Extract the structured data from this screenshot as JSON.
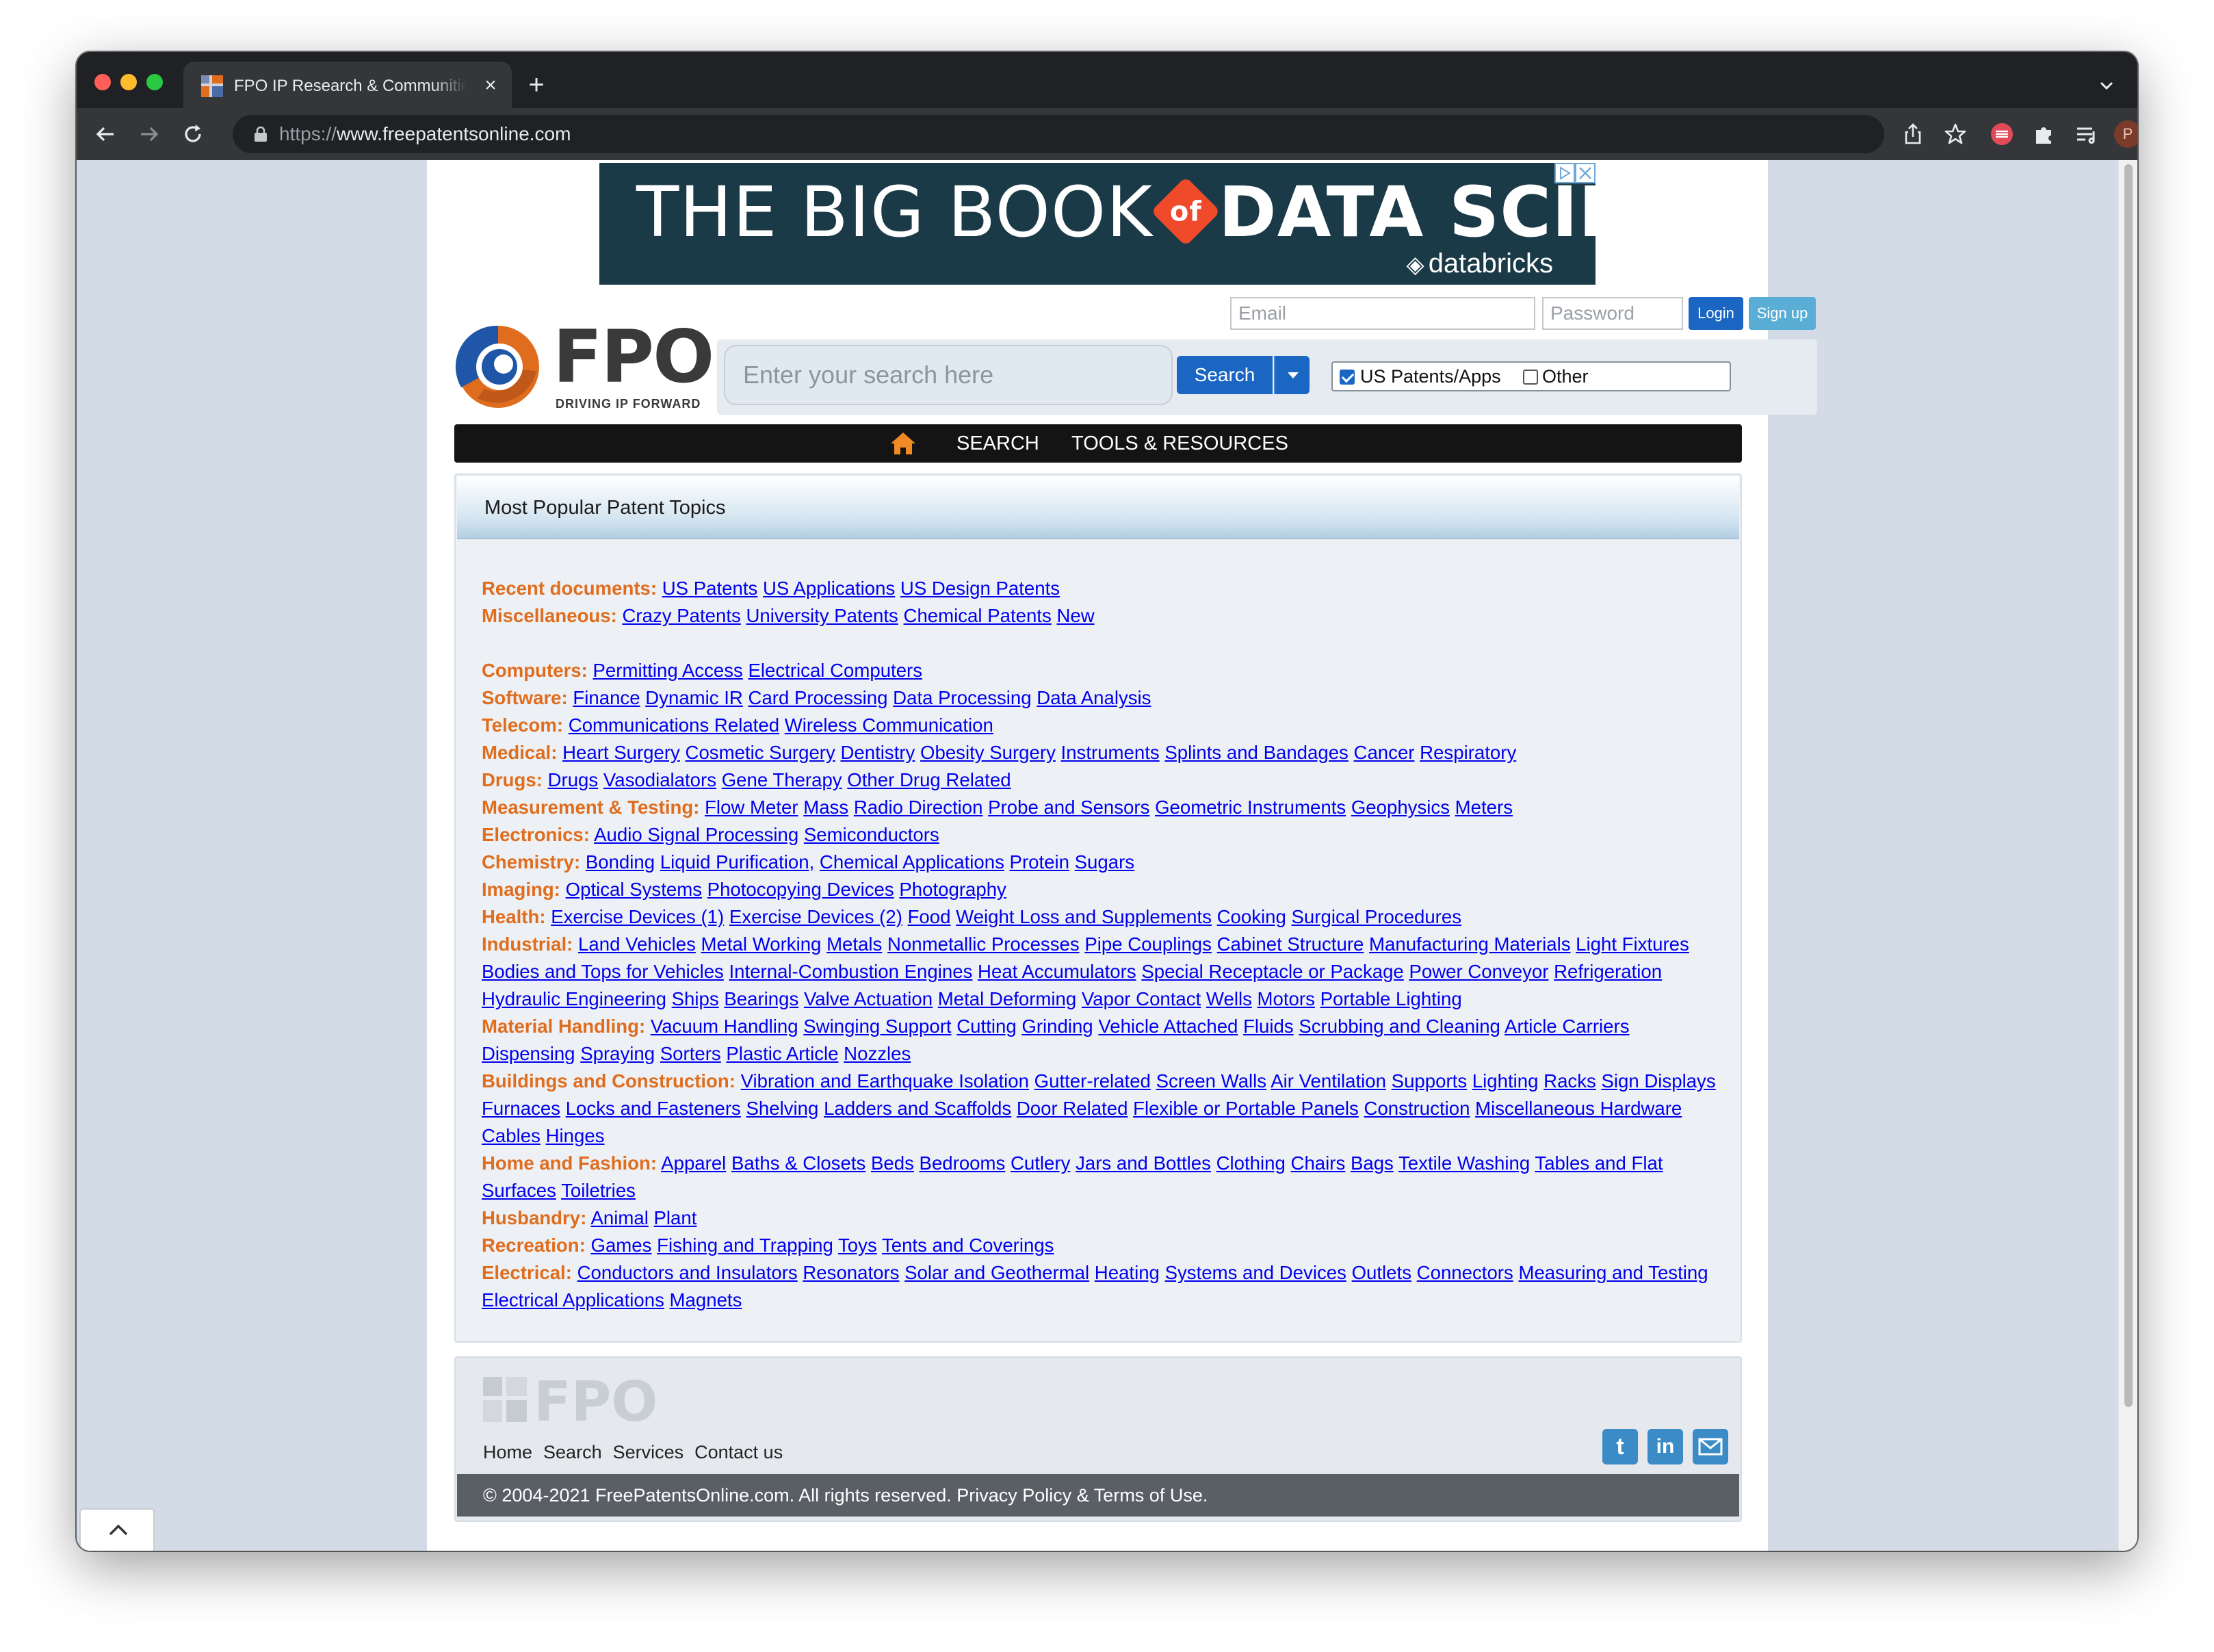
{
  "browser": {
    "tab_title": "FPO IP Research & Communities",
    "tab_close": "×",
    "new_tab": "+",
    "url_scheme": "https://",
    "url_host": "www.freepatentsonline.com",
    "profile_initial": "P"
  },
  "ad": {
    "headline_left": "THE BIG BOOK",
    "headline_of": "of",
    "headline_right": "DATA SCIENCE",
    "brand": "databricks",
    "brand_color": "#ef4b2a"
  },
  "auth": {
    "email_placeholder": "Email",
    "password_placeholder": "Password",
    "login_label": "Login",
    "signup_label": "Sign up"
  },
  "logo": {
    "wordmark": "FPO",
    "tagline": "DRIVING IP FORWARD"
  },
  "search": {
    "placeholder": "Enter your search here",
    "button_label": "Search",
    "scopes": [
      {
        "label": "US Patents/Apps",
        "checked": true
      },
      {
        "label": "Other",
        "checked": false
      }
    ]
  },
  "nav": {
    "home_icon": "home-icon",
    "items": [
      "SEARCH",
      "TOOLS & RESOURCES"
    ]
  },
  "topics_panel": {
    "title": "Most Popular Patent Topics"
  },
  "topic_groups": [
    {
      "category": "Recent documents:",
      "links": [
        "US Patents",
        "US Applications",
        "US Design Patents"
      ]
    },
    {
      "category": "Miscellaneous:",
      "links": [
        "Crazy Patents",
        "University Patents",
        "Chemical Patents",
        "New"
      ]
    },
    {
      "category": "Computers:",
      "links": [
        "Permitting Access",
        "Electrical Computers"
      ]
    },
    {
      "category": "Software:",
      "links": [
        "Finance",
        "Dynamic IR",
        "Card Processing",
        "Data Processing",
        "Data Analysis"
      ]
    },
    {
      "category": "Telecom:",
      "links": [
        "Communications Related",
        "Wireless Communication"
      ]
    },
    {
      "category": "Medical:",
      "links": [
        "Heart Surgery",
        "Cosmetic Surgery",
        "Dentistry",
        "Obesity Surgery",
        "Instruments",
        "Splints and Bandages",
        "Cancer",
        "Respiratory"
      ]
    },
    {
      "category": "Drugs:",
      "links": [
        "Drugs",
        "Vasodialators",
        "Gene Therapy",
        "Other Drug Related"
      ]
    },
    {
      "category": "Measurement & Testing:",
      "links": [
        "Flow Meter",
        "Mass",
        "Radio Direction",
        "Probe and Sensors",
        "Geometric Instruments",
        "Geophysics",
        "Meters"
      ]
    },
    {
      "category": "Electronics:",
      "links": [
        "Audio Signal Processing",
        "Semiconductors"
      ]
    },
    {
      "category": "Chemistry:",
      "links": [
        "Bonding",
        "Liquid Purification,",
        "Chemical Applications",
        "Protein",
        "Sugars"
      ]
    },
    {
      "category": "Imaging:",
      "links": [
        "Optical Systems",
        "Photocopying Devices",
        "Photography"
      ]
    },
    {
      "category": "Health:",
      "links": [
        "Exercise Devices (1)",
        "Exercise Devices (2)",
        "Food",
        "Weight Loss and Supplements",
        "Cooking",
        "Surgical Procedures"
      ]
    },
    {
      "category": "Industrial:",
      "links": [
        "Land Vehicles",
        "Metal Working",
        "Metals",
        "Nonmetallic Processes",
        "Pipe Couplings",
        "Cabinet Structure",
        "Manufacturing Materials",
        "Light Fixtures",
        "Bodies and Tops for Vehicles",
        "Internal-Combustion Engines",
        "Heat Accumulators",
        "Special Receptacle or Package",
        "Power Conveyor",
        "Refrigeration",
        "Hydraulic Engineering",
        "Ships",
        "Bearings",
        "Valve Actuation",
        "Metal Deforming",
        "Vapor Contact",
        "Wells",
        "Motors",
        "Portable Lighting"
      ]
    },
    {
      "category": "Material Handling:",
      "links": [
        "Vacuum Handling",
        "Swinging Support",
        "Cutting",
        "Grinding",
        "Vehicle Attached",
        "Fluids",
        "Scrubbing and Cleaning",
        "Article Carriers",
        "Dispensing",
        "Spraying",
        "Sorters",
        "Plastic Article",
        "Nozzles"
      ]
    },
    {
      "category": "Buildings and Construction:",
      "links": [
        "Vibration and Earthquake Isolation",
        "Gutter-related",
        "Screen Walls",
        "Air Ventilation",
        "Supports",
        "Lighting",
        "Racks",
        "Sign Displays",
        "Furnaces",
        "Locks and Fasteners",
        "Shelving",
        "Ladders and Scaffolds",
        "Door Related",
        "Flexible or Portable Panels",
        "Construction",
        "Miscellaneous Hardware",
        "Cables",
        "Hinges"
      ]
    },
    {
      "category": "Home and Fashion:",
      "links": [
        "Apparel",
        "Baths & Closets",
        "Beds",
        "Bedrooms",
        "Cutlery",
        "Jars and Bottles",
        "Clothing",
        "Chairs",
        "Bags",
        "Textile Washing",
        "Tables and Flat Surfaces",
        "Toiletries"
      ]
    },
    {
      "category": "Husbandry:",
      "links": [
        "Animal",
        "Plant"
      ]
    },
    {
      "category": "Recreation:",
      "links": [
        "Games",
        "Fishing and Trapping",
        "Toys",
        "Tents and Coverings"
      ]
    },
    {
      "category": "Electrical:",
      "links": [
        "Conductors and Insulators",
        "Resonators",
        "Solar and Geothermal",
        "Heating",
        "Systems and Devices",
        "Outlets",
        "Connectors",
        "Measuring and Testing",
        "Electrical Applications",
        "Magnets"
      ]
    }
  ],
  "footer": {
    "logo_text": "FPO",
    "nav": [
      "Home",
      "Search",
      "Services",
      "Contact us"
    ],
    "social": [
      "twitter-icon",
      "linkedin-icon",
      "email-icon"
    ],
    "copyright": "© 2004-2021 FreePatentsOnline.com. All rights reserved. Privacy Policy & Terms of Use."
  },
  "colors": {
    "category": "#e06d1e",
    "link": "#0000ee",
    "accent": "#1a66c2",
    "page_background": "#d3dce6"
  }
}
